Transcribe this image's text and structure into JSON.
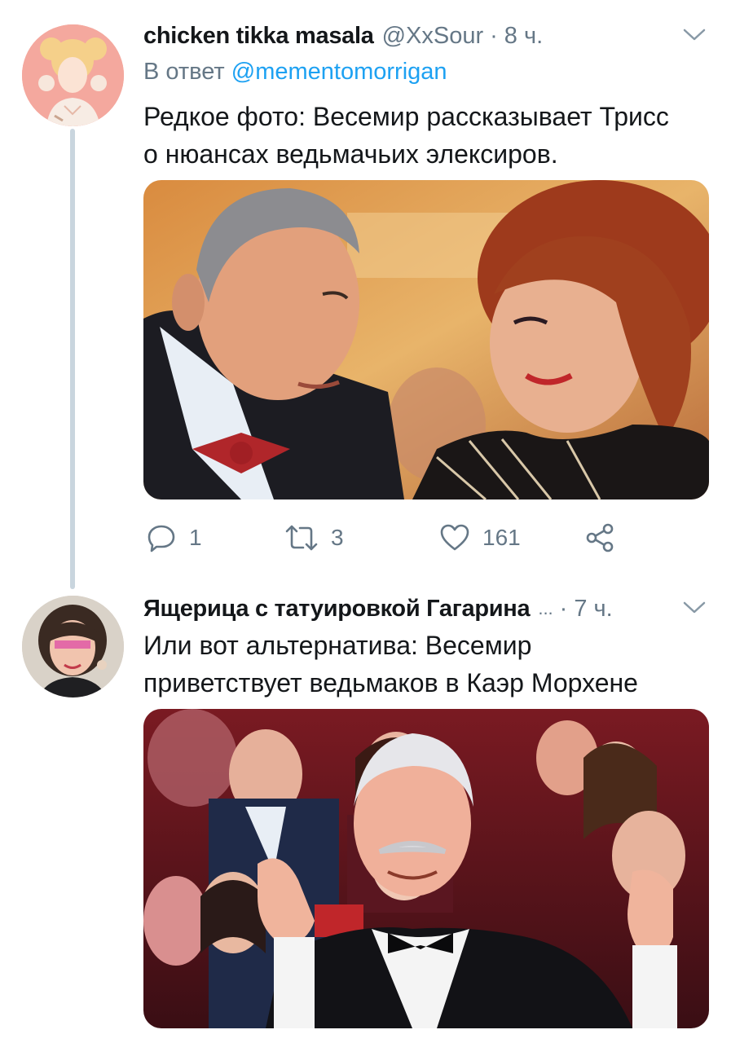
{
  "tweets": [
    {
      "author": {
        "display_name": "chicken tikka masala",
        "handle": "@XxSour",
        "avatar_icon": "avatar-illustration-icon"
      },
      "separator": "·",
      "time": "8 ч.",
      "reply_to": {
        "prefix": "В ответ",
        "mention": "@mementomorrigan"
      },
      "text_lines": [
        "Редкое фото: Весемир рассказывает Трисс",
        "о нюансах ведьмачьих элексиров."
      ],
      "media": {
        "type": "photo"
      },
      "actions": {
        "reply_count": "1",
        "retweet_count": "3",
        "like_count": "161"
      }
    },
    {
      "author": {
        "display_name": "Ящерица с татуировкой Гагарина",
        "ellipsis": "...",
        "avatar_icon": "avatar-photo-icon"
      },
      "separator": "·",
      "time": "7 ч.",
      "text_lines": [
        "Или вот альтернатива: Весемир",
        "приветствует ведьмаков в Каэр Морхене"
      ],
      "media": {
        "type": "photo"
      }
    }
  ],
  "colors": {
    "text_primary": "#14171a",
    "text_secondary": "#657786",
    "link": "#1da1f2",
    "thread_line": "#c9d5de"
  }
}
